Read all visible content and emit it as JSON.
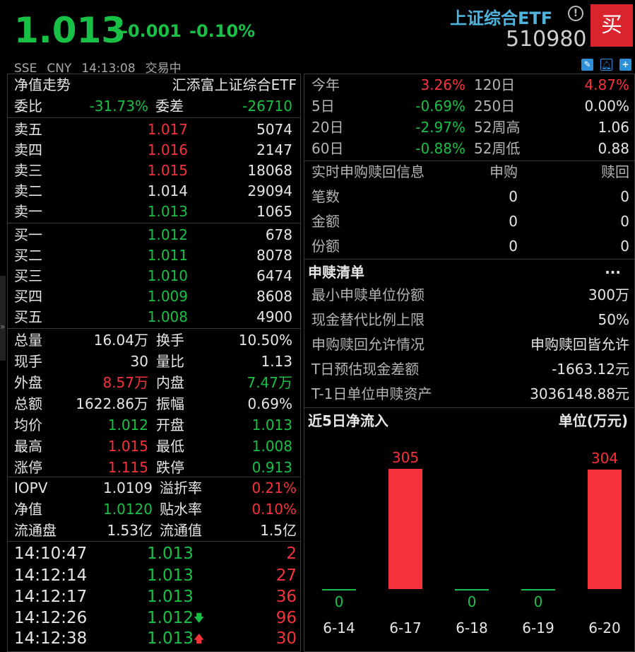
{
  "header": {
    "price": "1.013",
    "change": "-0.001",
    "change_pct": "-0.10%",
    "exchange": "SSE",
    "currency": "CNY",
    "time": "14:13:08",
    "status": "交易中",
    "name": "上证综合ETF",
    "code": "510980",
    "buy_label": "买",
    "info_glyph": "!"
  },
  "left": {
    "nav_title": "净值走势",
    "fund_name": "汇添富上证综合ETF",
    "weibi_label": "委比",
    "weibi_value": "-31.73%",
    "weicha_label": "委差",
    "weicha_value": "-26710",
    "asks": [
      {
        "label": "卖五",
        "price": "1.017",
        "vol": "5074"
      },
      {
        "label": "卖四",
        "price": "1.016",
        "vol": "2147"
      },
      {
        "label": "卖三",
        "price": "1.015",
        "vol": "18068"
      },
      {
        "label": "卖二",
        "price": "1.014",
        "vol": "29094"
      },
      {
        "label": "卖一",
        "price": "1.013",
        "vol": "1065"
      }
    ],
    "bids": [
      {
        "label": "买一",
        "price": "1.012",
        "vol": "678"
      },
      {
        "label": "买二",
        "price": "1.011",
        "vol": "8078"
      },
      {
        "label": "买三",
        "price": "1.010",
        "vol": "6474"
      },
      {
        "label": "买四",
        "price": "1.009",
        "vol": "8608"
      },
      {
        "label": "买五",
        "price": "1.008",
        "vol": "4900"
      }
    ],
    "stats": [
      {
        "l1": "总量",
        "v1": "16.04万",
        "l2": "换手",
        "v2": "10.50%"
      },
      {
        "l1": "现手",
        "v1": "30",
        "l2": "量比",
        "v2": "1.13"
      },
      {
        "l1": "外盘",
        "v1": "8.57万",
        "l2": "内盘",
        "v2": "7.47万"
      },
      {
        "l1": "总额",
        "v1": "1622.86万",
        "l2": "振幅",
        "v2": "0.69%"
      },
      {
        "l1": "均价",
        "v1": "1.012",
        "l2": "开盘",
        "v2": "1.013"
      },
      {
        "l1": "最高",
        "v1": "1.015",
        "l2": "最低",
        "v2": "1.008"
      },
      {
        "l1": "涨停",
        "v1": "1.115",
        "l2": "跌停",
        "v2": "0.913"
      }
    ],
    "iopv": [
      {
        "l1": "IOPV",
        "v1": "1.0109",
        "l2": "溢折率",
        "v2": "0.21%"
      },
      {
        "l1": "净值",
        "v1": "1.0120",
        "l2": "贴水率",
        "v2": "0.10%"
      },
      {
        "l1": "流通盘",
        "v1": "1.53亿",
        "l2": "流通值",
        "v2": "1.5亿"
      }
    ],
    "ticks": [
      {
        "time": "14:10:47",
        "price": "1.013",
        "arrow": "",
        "vol": "2"
      },
      {
        "time": "14:12:14",
        "price": "1.013",
        "arrow": "",
        "vol": "27"
      },
      {
        "time": "14:12:17",
        "price": "1.013",
        "arrow": "",
        "vol": "36"
      },
      {
        "time": "14:12:26",
        "price": "1.012",
        "arrow": "🡇",
        "vol": "96"
      },
      {
        "time": "14:12:38",
        "price": "1.013",
        "arrow": "🡅",
        "vol": "30"
      }
    ]
  },
  "right": {
    "perf": [
      {
        "l1": "今年",
        "v1": "3.26%",
        "l2": "120日",
        "v2": "4.87%"
      },
      {
        "l1": "5日",
        "v1": "-0.69%",
        "l2": "250日",
        "v2": "0.00%"
      },
      {
        "l1": "20日",
        "v1": "-2.97%",
        "l2": "52周高",
        "v2": "1.06"
      },
      {
        "l1": "60日",
        "v1": "-0.88%",
        "l2": "52周低",
        "v2": "0.88"
      }
    ],
    "realtime_title": "实时申购赎回信息",
    "subscribe_label": "申购",
    "redeem_label": "赎回",
    "realtime_rows": [
      {
        "label": "笔数",
        "sub": "0",
        "red": "0"
      },
      {
        "label": "金额",
        "sub": "0",
        "red": "0"
      },
      {
        "label": "份额",
        "sub": "0",
        "red": "0"
      }
    ],
    "list_title": "申赎清单",
    "more": "···",
    "list_rows": [
      {
        "label": "最小申赎单位份额",
        "value": "300万"
      },
      {
        "label": "现金替代比例上限",
        "value": "50%"
      },
      {
        "label": "申购赎回允许情况",
        "value": "申购赎回皆允许"
      },
      {
        "label": "T日预估现金差额",
        "value": "-1663.12元"
      },
      {
        "label": "T-1日单位申赎资产",
        "value": "3036148.88元"
      }
    ],
    "flow_title": "近5日净流入",
    "flow_unit": "单位(万元)"
  },
  "chart_data": {
    "type": "bar",
    "categories": [
      "6-14",
      "6-17",
      "6-18",
      "6-19",
      "6-20"
    ],
    "values": [
      0,
      305,
      0,
      0,
      304
    ],
    "title": "近5日净流入",
    "ylabel": "单位(万元)",
    "colors": {
      "positive": "#f5323a",
      "zero": "#18c046"
    }
  },
  "colors": {
    "up": "#f5323a",
    "down": "#18c046",
    "accent": "#2c8fd8",
    "name": "#4fb3dc",
    "buy": "#d9242c"
  }
}
